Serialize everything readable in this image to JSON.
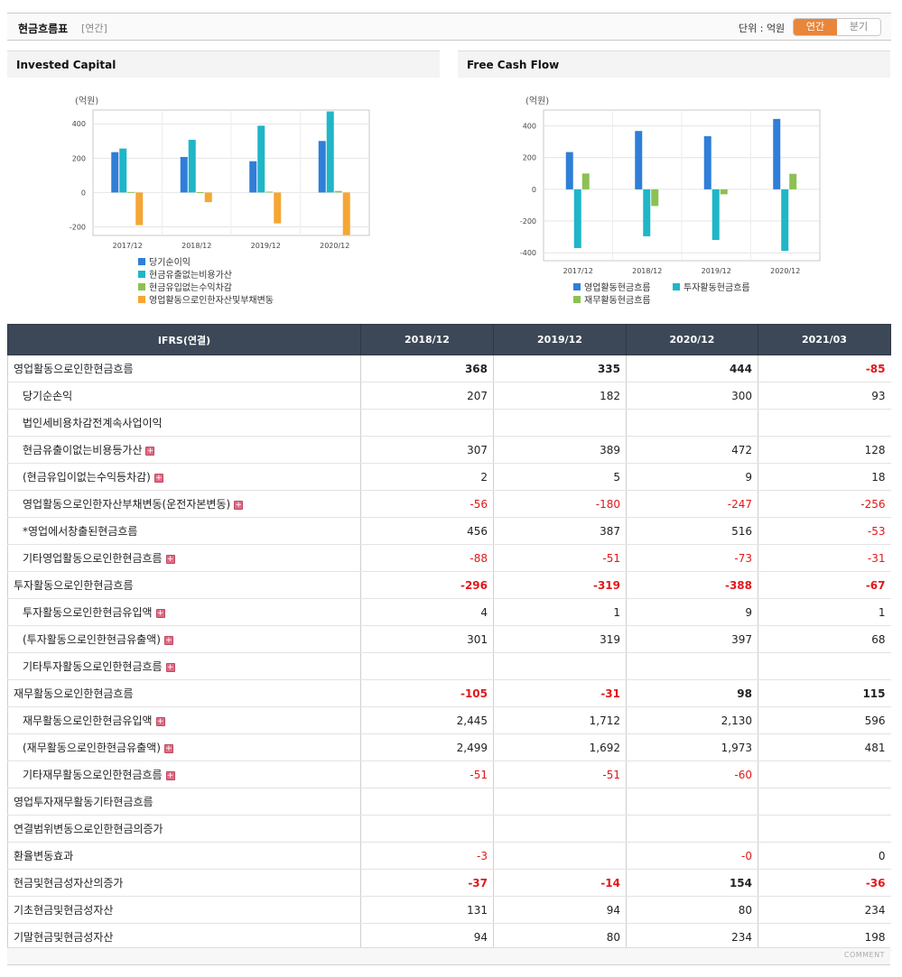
{
  "header": {
    "title": "현금흐름표",
    "subtitle": "[연간]",
    "unit": "단위 : 억원",
    "tab_annual": "연간",
    "tab_quarter": "분기"
  },
  "panels": {
    "left_title": "Invested Capital",
    "right_title": "Free Cash Flow"
  },
  "chart_data": [
    {
      "type": "bar",
      "title": "Invested Capital",
      "ylabel": "(억원)",
      "categories": [
        "2017/12",
        "2018/12",
        "2019/12",
        "2020/12"
      ],
      "ylim": [
        -250,
        480
      ],
      "yticks": [
        400,
        200,
        0,
        -200
      ],
      "legend": "bottom",
      "series": [
        {
          "name": "당기순이익",
          "color": "#2f7ed8",
          "values": [
            235,
            207,
            182,
            300
          ]
        },
        {
          "name": "현금유출없는비용가산",
          "color": "#1fb6c8",
          "values": [
            256,
            307,
            389,
            472
          ]
        },
        {
          "name": "현금유입없는수익차감",
          "color": "#8cc152",
          "values": [
            3,
            2,
            5,
            9
          ]
        },
        {
          "name": "영업활동으로인한자산및부채변동",
          "color": "#f5a634",
          "values": [
            -190,
            -56,
            -180,
            -247
          ]
        }
      ]
    },
    {
      "type": "bar",
      "title": "Free Cash Flow",
      "ylabel": "(억원)",
      "categories": [
        "2017/12",
        "2018/12",
        "2019/12",
        "2020/12"
      ],
      "ylim": [
        -450,
        500
      ],
      "yticks": [
        400,
        200,
        0,
        -200,
        -400
      ],
      "legend": "bottom",
      "series": [
        {
          "name": "영업활동현금흐름",
          "color": "#2f7ed8",
          "values": [
            235,
            368,
            335,
            444
          ]
        },
        {
          "name": "투자활동현금흐름",
          "color": "#1fb6c8",
          "values": [
            -370,
            -296,
            -319,
            -388
          ]
        },
        {
          "name": "재무활동현금흐름",
          "color": "#8cc152",
          "values": [
            100,
            -105,
            -31,
            98
          ]
        }
      ]
    }
  ],
  "table": {
    "corner": "IFRS(연결)",
    "columns": [
      "2018/12",
      "2019/12",
      "2020/12",
      "2021/03"
    ],
    "rows": [
      {
        "label": "영업활동으로인한현금흐름",
        "sub": false,
        "bold": true,
        "plus": false,
        "values": [
          "368",
          "335",
          "444",
          "-85"
        ]
      },
      {
        "label": "당기순손익",
        "sub": true,
        "bold": false,
        "plus": false,
        "values": [
          "207",
          "182",
          "300",
          "93"
        ]
      },
      {
        "label": "법인세비용차감전계속사업이익",
        "sub": true,
        "bold": false,
        "plus": false,
        "values": [
          "",
          "",
          "",
          ""
        ]
      },
      {
        "label": "현금유출이없는비용등가산",
        "sub": true,
        "bold": false,
        "plus": true,
        "values": [
          "307",
          "389",
          "472",
          "128"
        ]
      },
      {
        "label": "(현금유입이없는수익등차감)",
        "sub": true,
        "bold": false,
        "plus": true,
        "values": [
          "2",
          "5",
          "9",
          "18"
        ]
      },
      {
        "label": "영업활동으로인한자산부채변동(운전자본변동)",
        "sub": true,
        "bold": false,
        "plus": true,
        "values": [
          "-56",
          "-180",
          "-247",
          "-256"
        ]
      },
      {
        "label": "*영업에서창출된현금흐름",
        "sub": true,
        "bold": false,
        "plus": false,
        "values": [
          "456",
          "387",
          "516",
          "-53"
        ]
      },
      {
        "label": "기타영업활동으로인한현금흐름",
        "sub": true,
        "bold": false,
        "plus": true,
        "values": [
          "-88",
          "-51",
          "-73",
          "-31"
        ]
      },
      {
        "label": "투자활동으로인한현금흐름",
        "sub": false,
        "bold": true,
        "plus": false,
        "values": [
          "-296",
          "-319",
          "-388",
          "-67"
        ]
      },
      {
        "label": "투자활동으로인한현금유입액",
        "sub": true,
        "bold": false,
        "plus": true,
        "values": [
          "4",
          "1",
          "9",
          "1"
        ]
      },
      {
        "label": "(투자활동으로인한현금유출액)",
        "sub": true,
        "bold": false,
        "plus": true,
        "values": [
          "301",
          "319",
          "397",
          "68"
        ]
      },
      {
        "label": "기타투자활동으로인한현금흐름",
        "sub": true,
        "bold": false,
        "plus": true,
        "values": [
          "",
          "",
          "",
          ""
        ]
      },
      {
        "label": "재무활동으로인한현금흐름",
        "sub": false,
        "bold": true,
        "plus": false,
        "values": [
          "-105",
          "-31",
          "98",
          "115"
        ]
      },
      {
        "label": "재무활동으로인한현금유입액",
        "sub": true,
        "bold": false,
        "plus": true,
        "values": [
          "2,445",
          "1,712",
          "2,130",
          "596"
        ]
      },
      {
        "label": "(재무활동으로인한현금유출액)",
        "sub": true,
        "bold": false,
        "plus": true,
        "values": [
          "2,499",
          "1,692",
          "1,973",
          "481"
        ]
      },
      {
        "label": "기타재무활동으로인한현금흐름",
        "sub": true,
        "bold": false,
        "plus": true,
        "values": [
          "-51",
          "-51",
          "-60",
          ""
        ]
      },
      {
        "label": "영업투자재무활동기타현금흐름",
        "sub": false,
        "bold": false,
        "plus": false,
        "values": [
          "",
          "",
          "",
          ""
        ]
      },
      {
        "label": "연결범위변동으로인한현금의증가",
        "sub": false,
        "bold": false,
        "plus": false,
        "values": [
          "",
          "",
          "",
          ""
        ]
      },
      {
        "label": "환율변동효과",
        "sub": false,
        "bold": false,
        "plus": false,
        "values": [
          "-3",
          "",
          "-0",
          "0"
        ]
      },
      {
        "label": "현금및현금성자산의증가",
        "sub": false,
        "bold": true,
        "plus": false,
        "values": [
          "-37",
          "-14",
          "154",
          "-36"
        ]
      },
      {
        "label": "기초현금및현금성자산",
        "sub": false,
        "bold": false,
        "plus": false,
        "values": [
          "131",
          "94",
          "80",
          "234"
        ]
      },
      {
        "label": "기말현금및현금성자산",
        "sub": false,
        "bold": false,
        "plus": false,
        "values": [
          "94",
          "80",
          "234",
          "198"
        ]
      }
    ]
  },
  "footer": {
    "comment": "COMMENT"
  },
  "colors": {
    "accent": "#e8863a",
    "header_bg": "#3c4858",
    "negative": "#e0181a"
  }
}
